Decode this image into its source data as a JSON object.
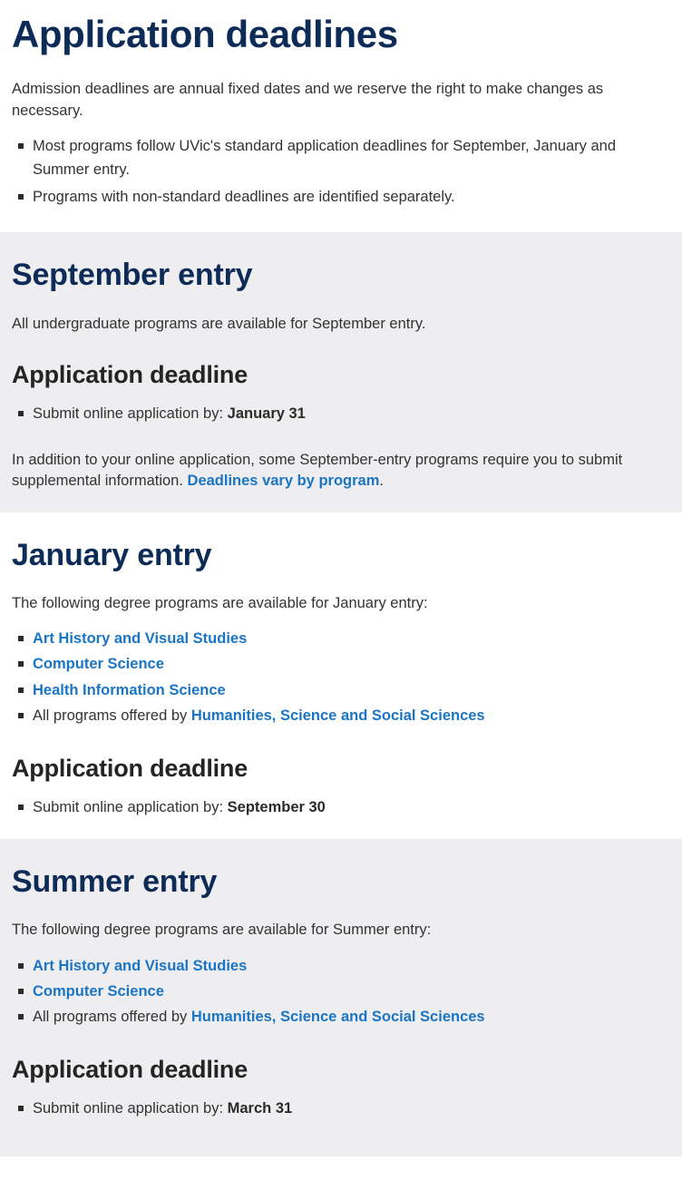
{
  "page": {
    "title": "Application deadlines",
    "intro": {
      "paragraph": "Admission deadlines are annual fixed dates and we reserve the right to make changes as necessary.",
      "bullets": [
        "Most programs follow UVic's standard application deadlines for September, January and Summer entry.",
        "Programs with non-standard deadlines are identified separately."
      ]
    }
  },
  "colors": {
    "heading_navy": "#0d2b57",
    "link_blue": "#1a76c4",
    "body_text": "#333333",
    "shade_background": "#eeedf0",
    "page_background": "#ffffff",
    "bullet_marker": "#2b2b2b"
  },
  "sections": {
    "september": {
      "title": "September entry",
      "lead": "All undergraduate programs are available for September entry.",
      "deadline_heading": "Application deadline",
      "deadline_label": "Submit online application by:",
      "deadline_date": "January 31",
      "note_before_link": "In addition to your online application, some September-entry programs require you to submit supplemental information. ",
      "note_link": "Deadlines vary by program",
      "note_after_link": "."
    },
    "january": {
      "title": "January entry",
      "lead": "The following degree programs are available for January entry:",
      "programs": [
        "Art History and Visual Studies",
        "Computer Science",
        "Health Information Science"
      ],
      "faculty_prefix": "All programs offered by ",
      "faculty_link": "Humanities, Science and Social Sciences",
      "deadline_heading": "Application deadline",
      "deadline_label": "Submit online application by:",
      "deadline_date": "September 30"
    },
    "summer": {
      "title": "Summer entry",
      "lead": "The following degree programs are available for Summer entry:",
      "programs": [
        "Art History and Visual Studies",
        "Computer Science"
      ],
      "faculty_prefix": "All programs offered by ",
      "faculty_link": "Humanities, Science and Social Sciences",
      "deadline_heading": "Application deadline",
      "deadline_label": "Submit online application by:",
      "deadline_date": "March 31"
    }
  }
}
